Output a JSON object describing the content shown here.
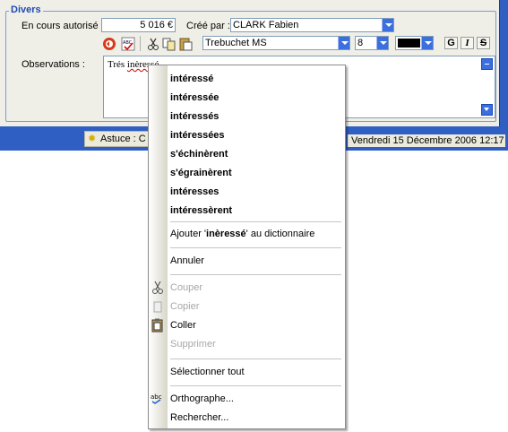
{
  "form": {
    "section_title": "Divers",
    "encours_label": "En cours autorisé :",
    "encours_value": "5 016 €",
    "cree_par_label": "Créé par :",
    "cree_par_value": "CLARK Fabien",
    "font_name": "Trebuchet MS",
    "font_size": "8",
    "font_color": "#000000",
    "bold_label": "G",
    "italic_label": "I",
    "strike_label": "S",
    "observations_label": "Observations :",
    "observations_word1": "Trés",
    "observations_word2": "inèressé"
  },
  "status": {
    "tip_label": "Astuce : C",
    "date": "Vendredi 15 Décembre 2006 12:17"
  },
  "context_menu": {
    "suggestions": [
      "intéressé",
      "intéressée",
      "intéressés",
      "intéressées",
      "s'échinèrent",
      "s'égrainèrent",
      "intéresses",
      "intéressèrent"
    ],
    "add_prefix": "Ajouter '",
    "add_word": "inèressé",
    "add_suffix": "' au dictionnaire",
    "undo": "Annuler",
    "cut": "Couper",
    "copy": "Copier",
    "paste": "Coller",
    "delete": "Supprimer",
    "select_all": "Sélectionner tout",
    "spelling": "Orthographe...",
    "search": "Rechercher..."
  },
  "colors": {
    "title_blue": "#1f49b5",
    "app_blue": "#2f5fc2",
    "misspell_red": "#d00000"
  }
}
